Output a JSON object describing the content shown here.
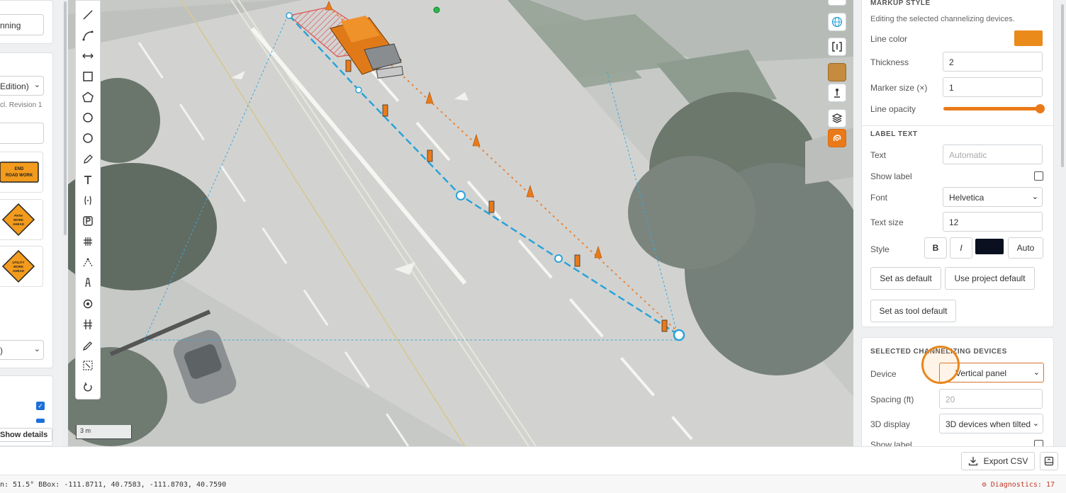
{
  "left_panel": {
    "top_input": "nning",
    "edition_select": "Edition)",
    "revision_text": "cl. Revision 1",
    "blank_input": "",
    "signs": [
      {
        "name": "end-road-work-sign",
        "lines": [
          "END",
          "ROAD WORK"
        ]
      },
      {
        "name": "path-work-ahead-sign",
        "lines": [
          "PATH",
          "WORK",
          "AHEAD"
        ]
      },
      {
        "name": "utility-work-ahead-sign",
        "lines": [
          "UTILITY",
          "WORK",
          "AHEAD"
        ]
      }
    ],
    "lower_select": ")",
    "show_details_label": "Show details"
  },
  "toolbar": {
    "tools": [
      "line-icon",
      "curve-icon",
      "measure-icon",
      "rectangle-icon",
      "pentagon-icon",
      "circle-icon",
      "circle-outline-icon",
      "pencil-icon",
      "text-icon",
      "bracket-icon",
      "parking-icon",
      "hash-icon",
      "triangle-path-icon",
      "tower-icon",
      "target-icon",
      "crossing-icon",
      "pen-icon",
      "select-area-icon",
      "undo-icon"
    ]
  },
  "map": {
    "scale_label": "3 m"
  },
  "right_tools": [
    "globe-icon",
    "bracket-view-icon",
    "basemap-thumb-icon",
    "person-icon",
    "layers-icon",
    "snap-icon"
  ],
  "markup_style": {
    "section_title": "MARKUP STYLE",
    "subtitle": "Editing the selected channelizing devices.",
    "line_color_label": "Line color",
    "line_color": "#ea8a1a",
    "thickness_label": "Thickness",
    "thickness": "2",
    "marker_size_label": "Marker size (×)",
    "marker_size": "1",
    "line_opacity_label": "Line opacity",
    "line_opacity": 1.0
  },
  "label_text": {
    "section_title": "LABEL TEXT",
    "text_label": "Text",
    "text_placeholder": "Automatic",
    "show_label_label": "Show label",
    "font_label": "Font",
    "font_value": "Helvetica",
    "text_size_label": "Text size",
    "text_size": "12",
    "style_label": "Style",
    "bold": "B",
    "italic": "I",
    "text_color": "#0b1020",
    "auto_label": "Auto",
    "set_default_btn": "Set as default",
    "use_project_default_btn": "Use project default",
    "set_tool_default_btn": "Set as tool default"
  },
  "channelizing": {
    "section_title": "SELECTED CHANNELIZING DEVICES",
    "device_label": "Device",
    "device_value": "Vertical panel",
    "spacing_label": "Spacing (ft)",
    "spacing_placeholder": "20",
    "display3d_label": "3D display",
    "display3d_value": "3D devices when tilted",
    "show_label_label": "Show label"
  },
  "footer": {
    "export_label": "Export CSV"
  },
  "status": {
    "left_text": "n: 51.5°   BBox: -111.8711, 40.7583, -111.8703, 40.7590",
    "diagnostics": "Diagnostics: 17"
  },
  "colors": {
    "accent": "#ea7a19",
    "route_line": "#2aa3d9",
    "offset_line": "#e8863a"
  }
}
